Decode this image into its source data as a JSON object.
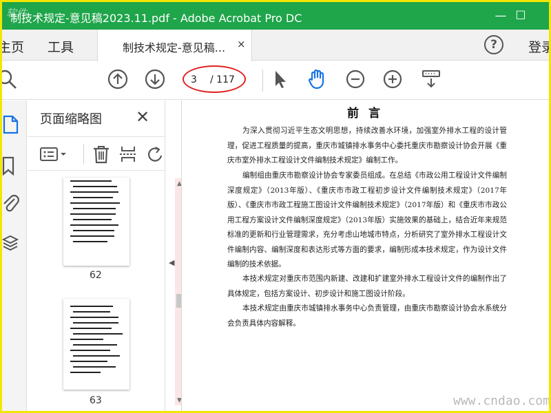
{
  "window": {
    "title": "制技术规定-意见稿2023.11.pdf - Adobe Acrobat Pro DC",
    "logo_text": "软件",
    "minimize_glyph": "—",
    "maximize_glyph": "☐"
  },
  "tabs": {
    "home": "主页",
    "tools": "工具",
    "document": "制技术规定-意见稿...",
    "close_glyph": "×",
    "help_glyph": "?",
    "signin": "登录"
  },
  "toolbar": {
    "current_page": "3",
    "total_pages": "/ 117",
    "icons": [
      "search-icon",
      "prev-page-icon",
      "next-page-icon",
      "select-cursor-icon",
      "hand-tool-icon",
      "zoom-out-icon",
      "zoom-in-icon",
      "scroll-mode-icon"
    ]
  },
  "thumbnails": {
    "title": "页面缩略图",
    "close_glyph": "✕",
    "pages": [
      {
        "label": "62"
      },
      {
        "label": "63"
      }
    ]
  },
  "document": {
    "heading": "前言",
    "paragraphs": [
      "为深入贯彻习近平生态文明思想，持续改善水环境，加强室外排水工程的设计管理，促进工程质量的提高，重庆市城镇排水事务中心委托重庆市勘察设计协会开展《重庆市室外排水工程设计文件编制技术规定》编制工作。",
      "编制组由重庆市勘察设计协会专家委员组成。在总结《市政公用工程设计文件编制深度规定》（2013年版）、《重庆市市政工程初步设计文件编制技术规定》（2017年版）、《重庆市市政工程施工图设计文件编制技术规定》（2017年版）和《重庆市市政公用工程方案设计文件编制深度规定》（2013年版）实施效果的基础上，结合近年来规范标准的更新和行业管理需求，充分考虑山地城市特点，分析研究了室外排水工程设计文件编制内容、编制深度和表达形式等方面的要求，编制形成本技术规定，作为设计文件编制的技术依据。",
      "本技术规定对重庆市范围内新建、改建和扩建室外排水工程设计文件的编制作出了具体规定，包括方案设计、初步设计和施工图设计阶段。",
      "本技术规定由重庆市城镇排水事务中心负责管理，由重庆市勘察设计协会水系统分会负责具体内容解释。"
    ]
  },
  "watermark": "www.cndao.com",
  "colors": {
    "titlebar": "#1fa54a",
    "frame": "#f3e600",
    "annotation": "#e01e1e",
    "hand_tool": "#1473e6"
  }
}
